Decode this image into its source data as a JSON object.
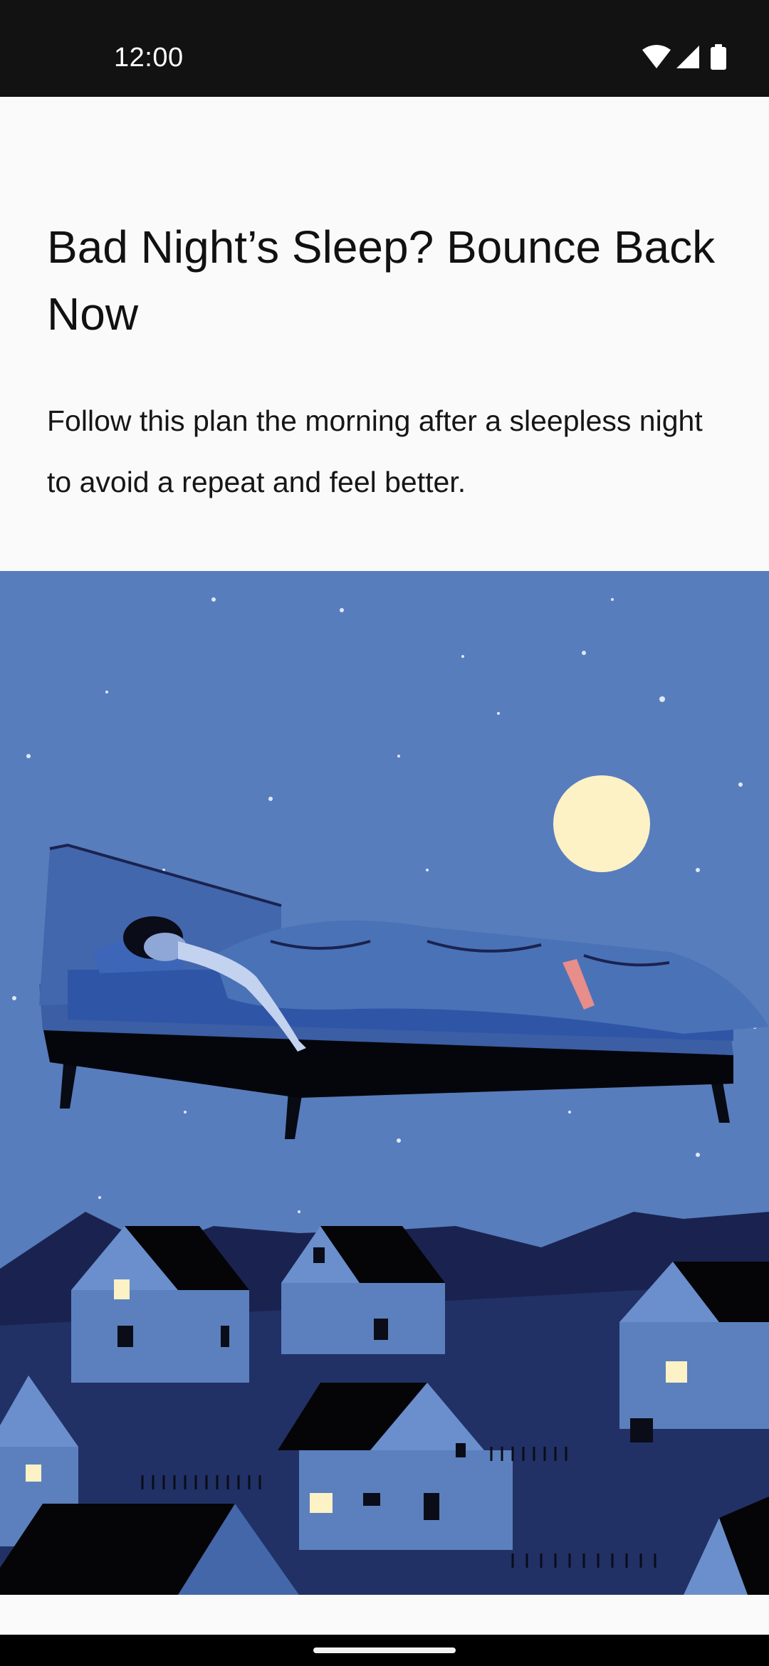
{
  "status_bar": {
    "time": "12:00",
    "icons": [
      "wifi-icon",
      "cell-signal-icon",
      "battery-icon"
    ]
  },
  "article": {
    "title": "Bad Night’s Sleep? Bounce Back Now",
    "summary": "Follow this plan the morning after a sleepless night to avoid a repeat and feel better."
  },
  "hero_image": {
    "subject": "woman-sleeping-on-floating-bed-over-houses-illustration"
  },
  "colors": {
    "status_bar_bg": "#121212",
    "page_bg": "#fafafa",
    "sky": "#587dbd",
    "moon": "#fdf1c6",
    "mountain": "#1a2350",
    "house": "#5b80bd",
    "roof": "#050508"
  }
}
